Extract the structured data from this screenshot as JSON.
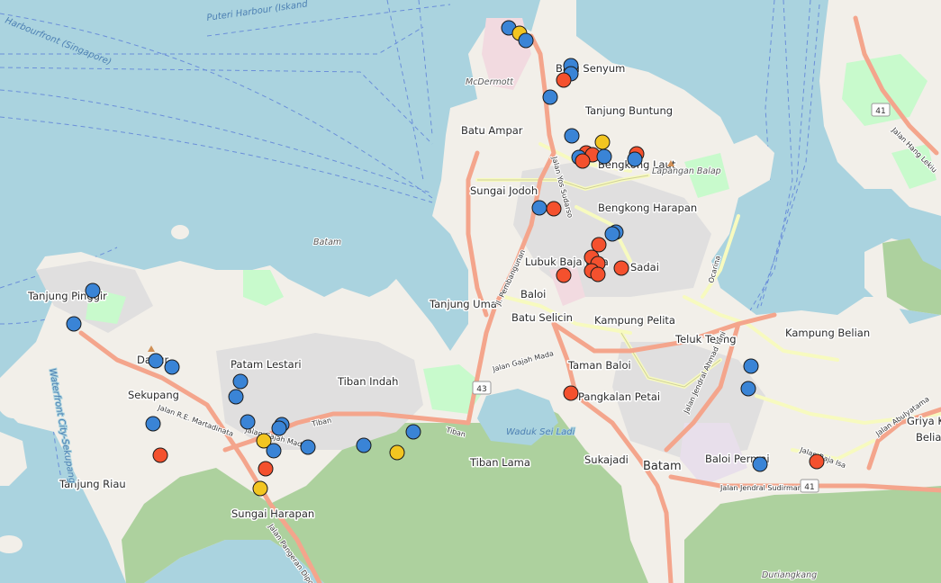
{
  "colors": {
    "water": "#aad3df",
    "land": "#f2efe9",
    "forest": "#add19e",
    "park": "#c8facc",
    "residential": "#e0dfdf",
    "commercial": "#f2dae0",
    "road_primary": "#f4a58c",
    "road_secondary": "#f7fabf",
    "marker_blue": "#3a84d6",
    "marker_red": "#f4512e",
    "marker_yellow": "#f2c521"
  },
  "place_labels": [
    {
      "name": "Batu Senyum"
    },
    {
      "name": "McDermott"
    },
    {
      "name": "Tanjung Buntung"
    },
    {
      "name": "Batu Ampar"
    },
    {
      "name": "Bengkong Laut"
    },
    {
      "name": "Lapangan Balap"
    },
    {
      "name": "Sungai Jodoh"
    },
    {
      "name": "Bengkong Harapan"
    },
    {
      "name": "Batam"
    },
    {
      "name": "Lubuk Baja Kota"
    },
    {
      "name": "Sadai"
    },
    {
      "name": "Tanjung Uma"
    },
    {
      "name": "Baloi"
    },
    {
      "name": "Batu Selicin"
    },
    {
      "name": "Kampung Pelita"
    },
    {
      "name": "Tanjung Pinggir"
    },
    {
      "name": "Dapur"
    },
    {
      "name": "Patam Lestari"
    },
    {
      "name": "Sekupang"
    },
    {
      "name": "Tiban Indah"
    },
    {
      "name": "Teluk Tering"
    },
    {
      "name": "Kampung Belian"
    },
    {
      "name": "Taman Baloi"
    },
    {
      "name": "Pangkalan Petai"
    },
    {
      "name": "Tiban Lama"
    },
    {
      "name": "Waduk Sei Ladi"
    },
    {
      "name": "Sukajadi"
    },
    {
      "name": "Batam"
    },
    {
      "name": "Baloi Permai"
    },
    {
      "name": "Griya K"
    },
    {
      "name": "Belian"
    },
    {
      "name": "Tanjung Riau"
    },
    {
      "name": "Sungai Harapan"
    },
    {
      "name": "Duriangkang"
    }
  ],
  "water_labels": [
    {
      "name": "Puteri Harbour (Iskand"
    },
    {
      "name": "Harbourfront (Singapore)"
    },
    {
      "name": "Waterfront City-Sekupang"
    }
  ],
  "road_labels": [
    {
      "name": "Jalan Gajah Mada"
    },
    {
      "name": "Jalan R.E. Martadinata"
    },
    {
      "name": "Tiban"
    },
    {
      "name": "Tiban"
    },
    {
      "name": "Jalan Pangeran Diponegoro"
    },
    {
      "name": "Jl. Pembangunan"
    },
    {
      "name": "Jalan Yos Sudarso"
    },
    {
      "name": "Ocarina"
    },
    {
      "name": "Jalan Jendral Ahmad Yani"
    },
    {
      "name": "Jalan Jendral Sudirman"
    },
    {
      "name": "Jalan Raja Isa"
    },
    {
      "name": "Jalan Abulyatama"
    },
    {
      "name": "Jalan Hang Lekiu"
    },
    {
      "name": "Jalan Gajah Mada"
    }
  ],
  "route_shields": [
    "41",
    "43",
    "41"
  ],
  "markers": [
    {
      "color": "blue"
    },
    {
      "color": "yellow"
    },
    {
      "color": "blue"
    },
    {
      "color": "blue"
    },
    {
      "color": "blue"
    },
    {
      "color": "red"
    },
    {
      "color": "blue"
    },
    {
      "color": "blue"
    },
    {
      "color": "yellow"
    },
    {
      "color": "red"
    },
    {
      "color": "red"
    },
    {
      "color": "blue"
    },
    {
      "color": "red"
    },
    {
      "color": "blue"
    },
    {
      "color": "red"
    },
    {
      "color": "blue"
    },
    {
      "color": "blue"
    },
    {
      "color": "red"
    },
    {
      "color": "blue"
    },
    {
      "color": "blue"
    },
    {
      "color": "red"
    },
    {
      "color": "red"
    },
    {
      "color": "red"
    },
    {
      "color": "red"
    },
    {
      "color": "red"
    },
    {
      "color": "red"
    },
    {
      "color": "red"
    },
    {
      "color": "blue"
    },
    {
      "color": "blue"
    },
    {
      "color": "blue"
    },
    {
      "color": "blue"
    },
    {
      "color": "blue"
    },
    {
      "color": "blue"
    },
    {
      "color": "blue"
    },
    {
      "color": "blue"
    },
    {
      "color": "blue"
    },
    {
      "color": "yellow"
    },
    {
      "color": "blue"
    },
    {
      "color": "red"
    },
    {
      "color": "yellow"
    },
    {
      "color": "blue"
    },
    {
      "color": "yellow"
    },
    {
      "color": "blue"
    },
    {
      "color": "blue"
    },
    {
      "color": "blue"
    },
    {
      "color": "red"
    },
    {
      "color": "red"
    },
    {
      "color": "blue"
    },
    {
      "color": "blue"
    },
    {
      "color": "blue"
    },
    {
      "color": "red"
    }
  ]
}
